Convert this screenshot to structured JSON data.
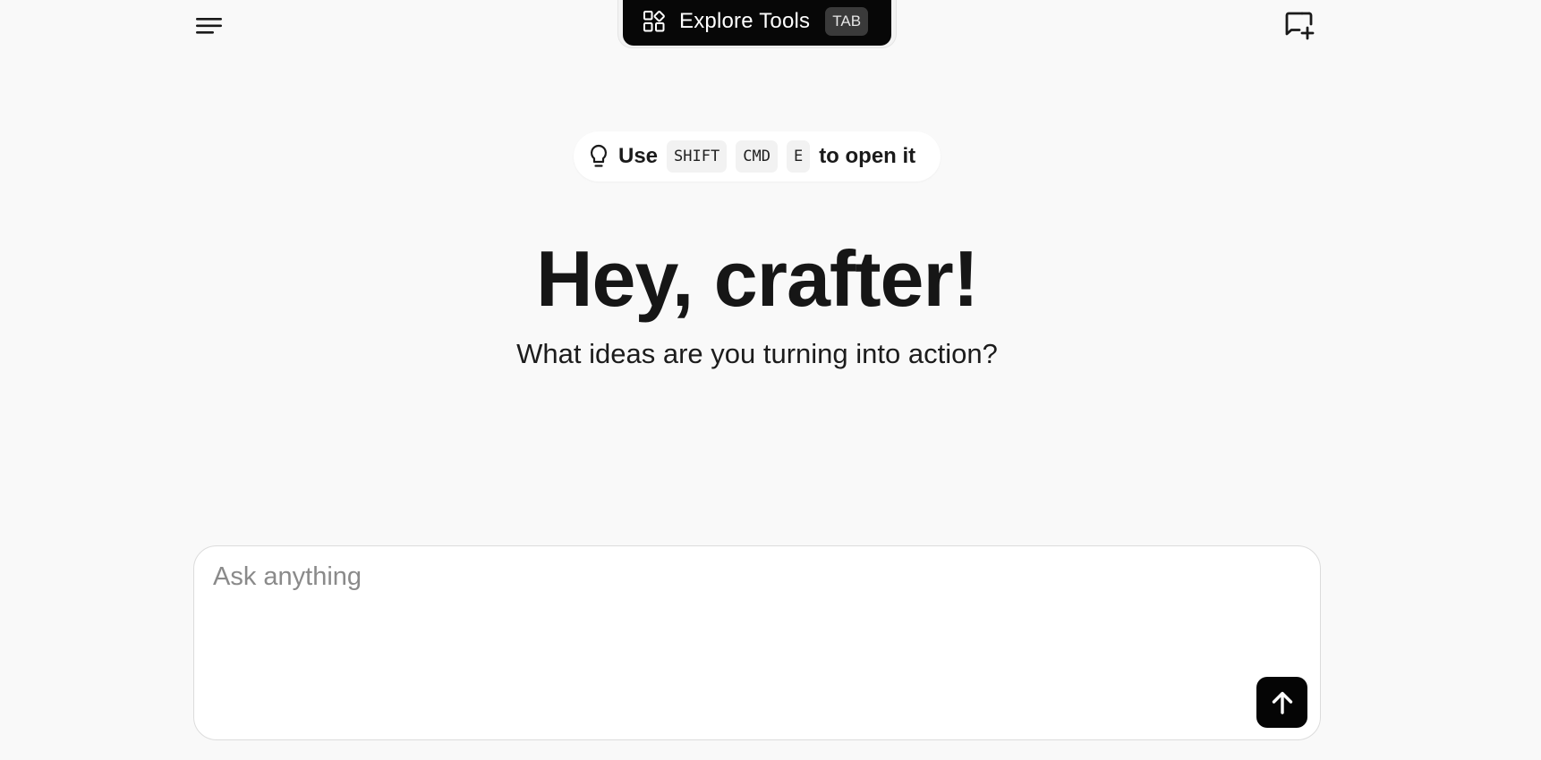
{
  "header": {
    "menu_icon": "hamburger-menu-icon",
    "new_chat_icon": "new-chat-icon"
  },
  "explore_tools": {
    "icon": "tools-grid-icon",
    "label": "Explore Tools",
    "shortcut": "TAB"
  },
  "hint": {
    "icon": "lightbulb-icon",
    "prefix": "Use",
    "keys": [
      "SHIFT",
      "CMD",
      "E"
    ],
    "suffix": "to open it"
  },
  "hero": {
    "title": "Hey, crafter!",
    "subtitle": "What ideas are you turning into action?"
  },
  "composer": {
    "placeholder": "Ask anything",
    "value": "",
    "send_icon": "arrow-up-icon"
  },
  "colors": {
    "background": "#f9f9f9",
    "explore_bar": "#070707",
    "send_button": "#050505",
    "text": "#161616"
  }
}
